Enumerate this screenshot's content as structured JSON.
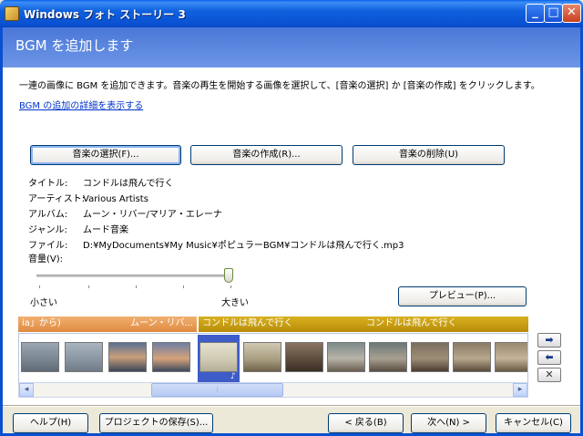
{
  "window": {
    "title": "Windows フォト ストーリー 3",
    "min_glyph": "_",
    "max_glyph": "□",
    "close_glyph": "✕"
  },
  "header": {
    "title": "BGM を追加します"
  },
  "main": {
    "description": "一連の画像に BGM を追加できます。音楽の再生を開始する画像を選択して、[音楽の選択] か [音楽の作成] をクリックします。",
    "details_link": "BGM の追加の詳細を表示する"
  },
  "music_buttons": {
    "select": "音楽の選択(F)...",
    "create": "音楽の作成(R)...",
    "delete": "音楽の削除(U)"
  },
  "track_info": [
    {
      "label": "タイトル:",
      "value": "コンドルは飛んで行く"
    },
    {
      "label": "アーティスト:",
      "value": "Various Artists"
    },
    {
      "label": "アルバム:",
      "value": "ムーン・リバー/マリア・エレーナ"
    },
    {
      "label": "ジャンル:",
      "value": "ムード音楽"
    },
    {
      "label": "ファイル:",
      "value": "D:¥MyDocuments¥My Music¥ポピュラーBGM¥コンドルは飛んで行く.mp3"
    }
  ],
  "volume": {
    "label": "音量(V):",
    "min_label": "小さい",
    "max_label": "大きい",
    "level_percent": 100
  },
  "preview_button": "プレビュー(P)...",
  "bgm_strip": [
    {
      "text": "ia」から)",
      "style": "orange"
    },
    {
      "text": "ムーン・リバ...",
      "style": "orange"
    },
    {
      "text": "コンドルは飛んで行く",
      "style": "gold"
    },
    {
      "text": "コンドルは飛んで行く",
      "style": "gold"
    }
  ],
  "filmstrip": {
    "selected_badge": "♪"
  },
  "side_buttons": {
    "move_right": "➡",
    "move_left": "⬅",
    "delete": "✕"
  },
  "scrollbar": {
    "left_arrow": "◂",
    "right_arrow": "▸",
    "grip": "⦙"
  },
  "footer": {
    "help": "ヘルプ(H)",
    "save_project": "プロジェクトの保存(S)...",
    "back": "< 戻る(B)",
    "next": "次へ(N) >",
    "cancel": "キャンセル(C)"
  },
  "colors": {
    "accent": "#0A50D0",
    "header": "#4A78D8",
    "strip_orange": "#E08A40",
    "strip_gold": "#C29A10",
    "link": "#0033CC"
  }
}
